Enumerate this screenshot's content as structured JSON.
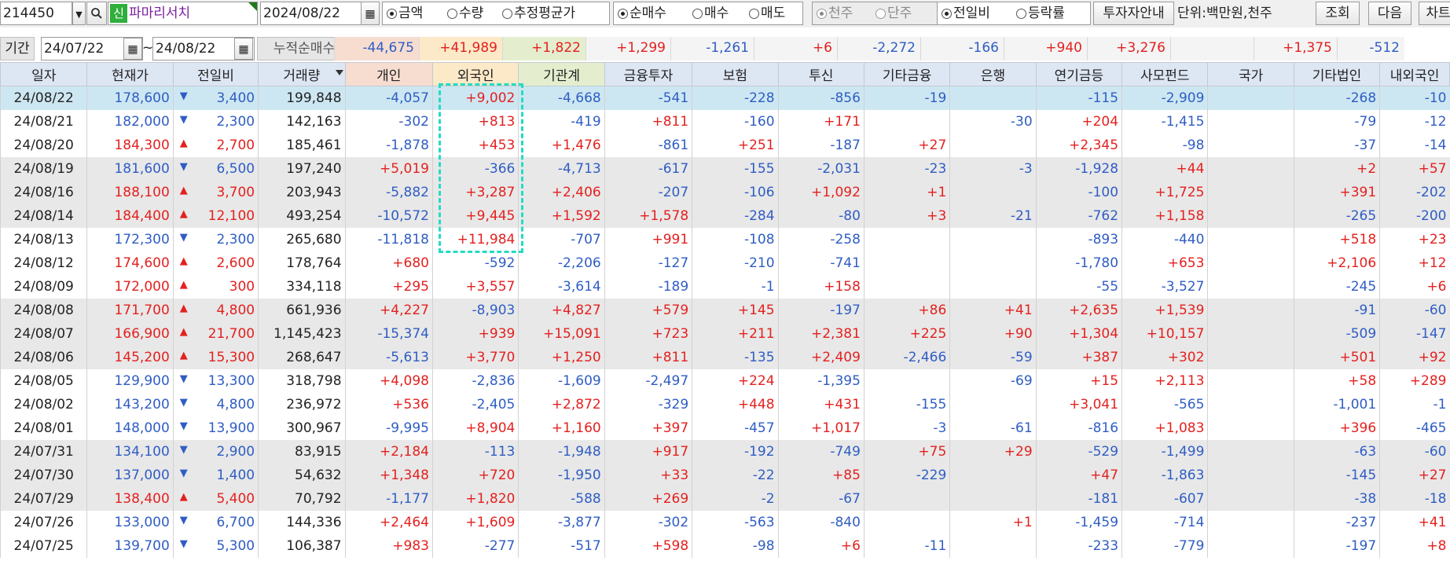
{
  "toolbar": {
    "code": "214450",
    "badge": "신",
    "stock_name": "파마리서치",
    "date": "2024/08/22",
    "radio_group_1": [
      "금액",
      "수량",
      "추정평균가"
    ],
    "radio_group_2": [
      "순매수",
      "매수",
      "매도"
    ],
    "radio_group_3": [
      "천주",
      "단주"
    ],
    "radio_group_4": [
      "전일비",
      "등락률"
    ],
    "investor_info_label": "투자자안내",
    "unit_text": "단위:백만원,천주",
    "query_label": "조회",
    "next_label": "다음",
    "chart_label": "차트"
  },
  "period": {
    "label": "기간",
    "from": "24/07/22",
    "tilde": "~",
    "to": "24/08/22",
    "cum_label": "누적순매수",
    "cum_values": [
      "-44,675",
      "+41,989",
      "+1,822",
      "+1,299",
      "-1,261",
      "+6",
      "-2,272",
      "-166",
      "+940",
      "+3,276",
      "",
      "+1,375",
      "-512"
    ]
  },
  "colors": {
    "up": "#e3211f",
    "down": "#2f5dc4",
    "highlight": "#22dbc4",
    "selected_row": "#cde7f2",
    "header": "#dde6f3"
  },
  "columns": [
    "일자",
    "현재가",
    "전일비",
    "거래량",
    "개인",
    "외국인",
    "기관계",
    "금융투자",
    "보험",
    "투신",
    "기타금융",
    "은행",
    "연기금등",
    "사모펀드",
    "국가",
    "기타법인",
    "내외국인"
  ],
  "rows": [
    {
      "date": "24/08/22",
      "price": "178,600",
      "dir": "down",
      "change": "3,400",
      "volume": "199,848",
      "vals": [
        "-4,057",
        "+9,002",
        "-4,668",
        "-541",
        "-228",
        "-856",
        "-19",
        "",
        "-115",
        "-2,909",
        "",
        "-268",
        "-10"
      ]
    },
    {
      "date": "24/08/21",
      "price": "182,000",
      "dir": "down",
      "change": "2,300",
      "volume": "142,163",
      "vals": [
        "-302",
        "+813",
        "-419",
        "+811",
        "-160",
        "+171",
        "",
        "-30",
        "+204",
        "-1,415",
        "",
        "-79",
        "-12"
      ]
    },
    {
      "date": "24/08/20",
      "price": "184,300",
      "dir": "up",
      "change": "2,700",
      "volume": "185,461",
      "vals": [
        "-1,878",
        "+453",
        "+1,476",
        "-861",
        "+251",
        "-187",
        "+27",
        "",
        "+2,345",
        "-98",
        "",
        "-37",
        "-14"
      ]
    },
    {
      "date": "24/08/19",
      "price": "181,600",
      "dir": "down",
      "change": "6,500",
      "volume": "197,240",
      "vals": [
        "+5,019",
        "-366",
        "-4,713",
        "-617",
        "-155",
        "-2,031",
        "-23",
        "-3",
        "-1,928",
        "+44",
        "",
        "+2",
        "+57"
      ]
    },
    {
      "date": "24/08/16",
      "price": "188,100",
      "dir": "up",
      "change": "3,700",
      "volume": "203,943",
      "vals": [
        "-5,882",
        "+3,287",
        "+2,406",
        "-207",
        "-106",
        "+1,092",
        "+1",
        "",
        "-100",
        "+1,725",
        "",
        "+391",
        "-202"
      ]
    },
    {
      "date": "24/08/14",
      "price": "184,400",
      "dir": "up",
      "change": "12,100",
      "volume": "493,254",
      "vals": [
        "-10,572",
        "+9,445",
        "+1,592",
        "+1,578",
        "-284",
        "-80",
        "+3",
        "-21",
        "-762",
        "+1,158",
        "",
        "-265",
        "-200"
      ]
    },
    {
      "date": "24/08/13",
      "price": "172,300",
      "dir": "down",
      "change": "2,300",
      "volume": "265,680",
      "vals": [
        "-11,818",
        "+11,984",
        "-707",
        "+991",
        "-108",
        "-258",
        "",
        "",
        "-893",
        "-440",
        "",
        "+518",
        "+23"
      ]
    },
    {
      "date": "24/08/12",
      "price": "174,600",
      "dir": "up",
      "change": "2,600",
      "volume": "178,764",
      "vals": [
        "+680",
        "-592",
        "-2,206",
        "-127",
        "-210",
        "-741",
        "",
        "",
        "-1,780",
        "+653",
        "",
        "+2,106",
        "+12"
      ]
    },
    {
      "date": "24/08/09",
      "price": "172,000",
      "dir": "up",
      "change": "300",
      "volume": "334,118",
      "vals": [
        "+295",
        "+3,557",
        "-3,614",
        "-189",
        "-1",
        "+158",
        "",
        "",
        "-55",
        "-3,527",
        "",
        "-245",
        "+6"
      ]
    },
    {
      "date": "24/08/08",
      "price": "171,700",
      "dir": "up",
      "change": "4,800",
      "volume": "661,936",
      "vals": [
        "+4,227",
        "-8,903",
        "+4,827",
        "+579",
        "+145",
        "-197",
        "+86",
        "+41",
        "+2,635",
        "+1,539",
        "",
        "-91",
        "-60"
      ]
    },
    {
      "date": "24/08/07",
      "price": "166,900",
      "dir": "up",
      "change": "21,700",
      "volume": "1,145,423",
      "vals": [
        "-15,374",
        "+939",
        "+15,091",
        "+723",
        "+211",
        "+2,381",
        "+225",
        "+90",
        "+1,304",
        "+10,157",
        "",
        "-509",
        "-147"
      ]
    },
    {
      "date": "24/08/06",
      "price": "145,200",
      "dir": "up",
      "change": "15,300",
      "volume": "268,647",
      "vals": [
        "-5,613",
        "+3,770",
        "+1,250",
        "+811",
        "-135",
        "+2,409",
        "-2,466",
        "-59",
        "+387",
        "+302",
        "",
        "+501",
        "+92"
      ]
    },
    {
      "date": "24/08/05",
      "price": "129,900",
      "dir": "down",
      "change": "13,300",
      "volume": "318,798",
      "vals": [
        "+4,098",
        "-2,836",
        "-1,609",
        "-2,497",
        "+224",
        "-1,395",
        "",
        "-69",
        "+15",
        "+2,113",
        "",
        "+58",
        "+289"
      ]
    },
    {
      "date": "24/08/02",
      "price": "143,200",
      "dir": "down",
      "change": "4,800",
      "volume": "236,972",
      "vals": [
        "+536",
        "-2,405",
        "+2,872",
        "-329",
        "+448",
        "+431",
        "-155",
        "",
        "+3,041",
        "-565",
        "",
        "-1,001",
        "-1"
      ]
    },
    {
      "date": "24/08/01",
      "price": "148,000",
      "dir": "down",
      "change": "13,900",
      "volume": "300,967",
      "vals": [
        "-9,995",
        "+8,904",
        "+1,160",
        "+397",
        "-457",
        "+1,017",
        "-3",
        "-61",
        "-816",
        "+1,083",
        "",
        "+396",
        "-465"
      ]
    },
    {
      "date": "24/07/31",
      "price": "134,100",
      "dir": "down",
      "change": "2,900",
      "volume": "83,915",
      "vals": [
        "+2,184",
        "-113",
        "-1,948",
        "+917",
        "-192",
        "-749",
        "+75",
        "+29",
        "-529",
        "-1,499",
        "",
        "-63",
        "-60"
      ]
    },
    {
      "date": "24/07/30",
      "price": "137,000",
      "dir": "down",
      "change": "1,400",
      "volume": "54,632",
      "vals": [
        "+1,348",
        "+720",
        "-1,950",
        "+33",
        "-22",
        "+85",
        "-229",
        "",
        "+47",
        "-1,863",
        "",
        "-145",
        "+27"
      ]
    },
    {
      "date": "24/07/29",
      "price": "138,400",
      "dir": "up",
      "change": "5,400",
      "volume": "70,792",
      "vals": [
        "-1,177",
        "+1,820",
        "-588",
        "+269",
        "-2",
        "-67",
        "",
        "",
        "-181",
        "-607",
        "",
        "-38",
        "-18"
      ]
    },
    {
      "date": "24/07/26",
      "price": "133,000",
      "dir": "down",
      "change": "6,700",
      "volume": "144,336",
      "vals": [
        "+2,464",
        "+1,609",
        "-3,877",
        "-302",
        "-563",
        "-840",
        "",
        "+1",
        "-1,459",
        "-714",
        "",
        "-237",
        "+41"
      ]
    },
    {
      "date": "24/07/25",
      "price": "139,700",
      "dir": "down",
      "change": "5,300",
      "volume": "106,387",
      "vals": [
        "+983",
        "-277",
        "-517",
        "+598",
        "-98",
        "+6",
        "-11",
        "",
        "-233",
        "-779",
        "",
        "-197",
        "+8"
      ]
    }
  ]
}
